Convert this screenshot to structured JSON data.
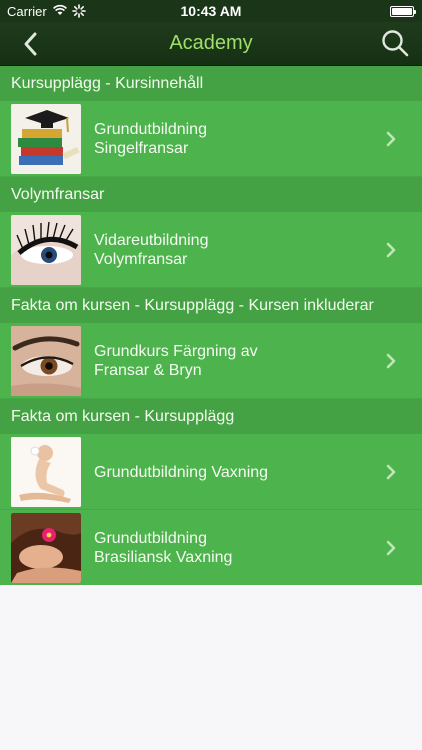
{
  "status": {
    "carrier": "Carrier",
    "time": "10:43 AM"
  },
  "nav": {
    "title": "Academy",
    "back_icon": "chevron-left-icon",
    "search_icon": "search-icon"
  },
  "colors": {
    "nav_bg": "#1f3b1c",
    "title": "#9ee06a",
    "row_bg": "#4db34d",
    "header_bg": "#44a244"
  },
  "sections": [
    {
      "header": "Kursupplägg - Kursinnehåll",
      "rows": [
        {
          "line1": "Grundutbildning",
          "line2": "Singelfransar",
          "thumb": "graduation-books"
        }
      ]
    },
    {
      "header": "Volymfransar",
      "rows": [
        {
          "line1": "Vidareutbildning",
          "line2": "Volymfransar",
          "thumb": "eyelash-closeup"
        }
      ]
    },
    {
      "header": "Fakta om kursen - Kursupplägg - Kursen inkluderar",
      "rows": [
        {
          "line1": "Grundkurs Färgning av",
          "line2": "Fransar & Bryn",
          "thumb": "eye-brow"
        }
      ]
    },
    {
      "header": "Fakta om kursen - Kursupplägg",
      "rows": [
        {
          "line1": "Grundutbildning Vaxning",
          "line2": "",
          "thumb": "waxing-legs"
        },
        {
          "line1": "Grundutbildning",
          "line2": "Brasiliansk Vaxning",
          "thumb": "spa-woman"
        }
      ]
    }
  ]
}
